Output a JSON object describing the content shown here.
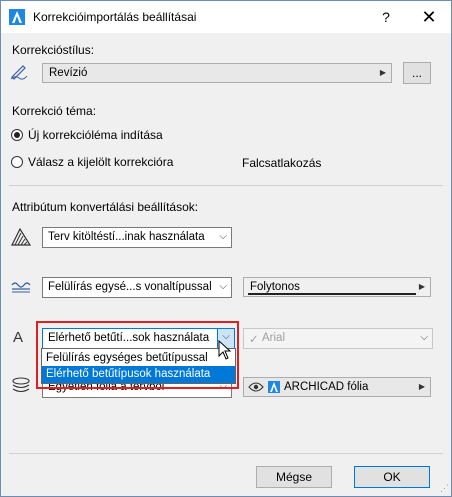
{
  "window": {
    "title": "Korrekcióimportálás beállításai",
    "help_label": "?",
    "close_label": "✕"
  },
  "style_section": {
    "label": "Korrekcióstílus:",
    "value": "Revízió",
    "browse_label": "..."
  },
  "topic_section": {
    "label": "Korrekció téma:",
    "options": [
      {
        "label": "Új korrekcióléma indítása",
        "selected": true
      },
      {
        "label": "Válasz a kijelölt korrekcióra",
        "selected": false
      }
    ],
    "selected_topic": "Falcsatlakozás"
  },
  "attr_section": {
    "label": "Attribútum konvertálási beállítások:",
    "fill": {
      "value": "Terv kitöltéstí...inak használata"
    },
    "line": {
      "value": "Felülírás egysé...s vonaltípussal",
      "linetype": "Folytonos"
    },
    "font": {
      "value": "Elérhető betűtí...sok használata",
      "font_value": "Arial",
      "check": "✓"
    },
    "layer": {
      "value": "Egyetlen fólia a tervből",
      "layer_value": "ARCHICAD fólia"
    }
  },
  "font_dropdown": {
    "options": [
      {
        "label": "Felülírás egységes betűtípussal",
        "selected": false
      },
      {
        "label": "Elérhető betűtípusok használata",
        "selected": true
      }
    ]
  },
  "buttons": {
    "cancel": "Mégse",
    "ok": "OK"
  },
  "colors": {
    "accent": "#0078d7",
    "highlight": "#e02020"
  }
}
